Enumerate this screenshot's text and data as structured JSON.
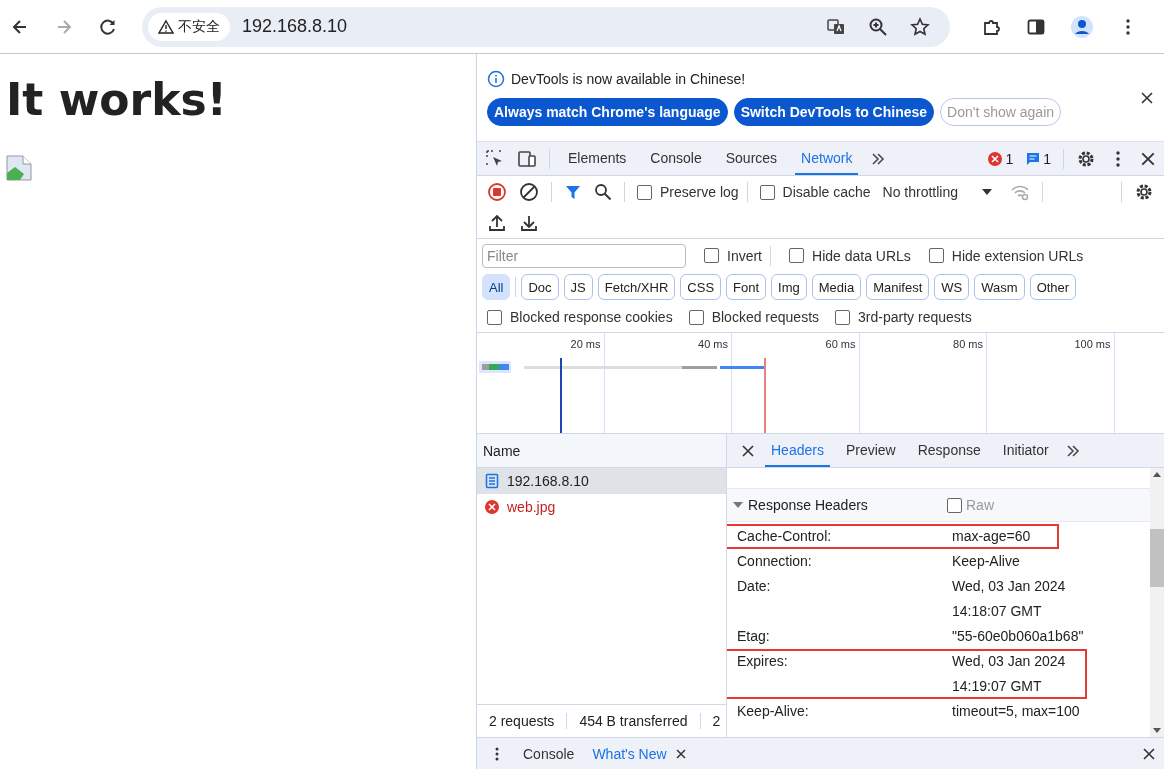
{
  "browser": {
    "forward_disabled": true,
    "security_label": "不安全",
    "url": "192.168.8.10"
  },
  "page": {
    "heading": "It works!"
  },
  "infobar": {
    "message": "DevTools is now available in Chinese!",
    "buttons": [
      {
        "label": "Always match Chrome's language",
        "kind": "primary"
      },
      {
        "label": "Switch DevTools to Chinese",
        "kind": "primary"
      },
      {
        "label": "Don't show again",
        "kind": "outline"
      }
    ]
  },
  "tabs": [
    {
      "label": "Elements",
      "selected": false
    },
    {
      "label": "Console",
      "selected": false
    },
    {
      "label": "Sources",
      "selected": false
    },
    {
      "label": "Network",
      "selected": true
    }
  ],
  "errors": "1",
  "messages": "1",
  "toolbar": {
    "recording": true,
    "filter_active": true,
    "options": [
      {
        "label": "Preserve log",
        "checked": false
      },
      {
        "label": "Disable cache",
        "checked": false
      }
    ],
    "throttling": "No throttling"
  },
  "filter": {
    "placeholder": "Filter",
    "options": [
      {
        "label": "Invert",
        "checked": false
      },
      {
        "label": "Hide data URLs",
        "checked": false
      },
      {
        "label": "Hide extension URLs",
        "checked": false
      }
    ]
  },
  "type_filters": [
    {
      "label": "All",
      "selected": true
    },
    {
      "label": "Doc",
      "selected": false
    },
    {
      "label": "JS",
      "selected": false
    },
    {
      "label": "Fetch/XHR",
      "selected": false
    },
    {
      "label": "CSS",
      "selected": false
    },
    {
      "label": "Font",
      "selected": false
    },
    {
      "label": "Img",
      "selected": false
    },
    {
      "label": "Media",
      "selected": false
    },
    {
      "label": "Manifest",
      "selected": false
    },
    {
      "label": "WS",
      "selected": false
    },
    {
      "label": "Wasm",
      "selected": false
    },
    {
      "label": "Other",
      "selected": false
    }
  ],
  "blocked": [
    {
      "label": "Blocked response cookies",
      "checked": false
    },
    {
      "label": "Blocked requests",
      "checked": false
    },
    {
      "label": "3rd-party requests",
      "checked": false
    }
  ],
  "overview": {
    "ticks": [
      "20 ms",
      "40 ms",
      "60 ms",
      "80 ms",
      "100 ms"
    ]
  },
  "requests": {
    "column": "Name",
    "rows": [
      {
        "name": "192.168.8.10",
        "kind": "document",
        "selected": true
      },
      {
        "name": "web.jpg",
        "kind": "error",
        "selected": false
      }
    ]
  },
  "status_bar": [
    "2 requests",
    "454 B transferred",
    "2"
  ],
  "details": {
    "tabs": [
      {
        "label": "Headers",
        "selected": true
      },
      {
        "label": "Preview",
        "selected": false
      },
      {
        "label": "Response",
        "selected": false
      },
      {
        "label": "Initiator",
        "selected": false
      }
    ],
    "section": {
      "title": "Response Headers",
      "expanded": true,
      "raw_label": "Raw",
      "raw": false,
      "headers": [
        {
          "name": "Cache-Control:",
          "lines": [
            "max-age=60"
          ],
          "highlighted": true
        },
        {
          "name": "Connection:",
          "lines": [
            "Keep-Alive"
          ],
          "highlighted": false
        },
        {
          "name": "Date:",
          "lines": [
            "Wed, 03 Jan 2024",
            "14:18:07 GMT"
          ],
          "highlighted": false
        },
        {
          "name": "Etag:",
          "lines": [
            "\"55-60e0b060a1b68\""
          ],
          "highlighted": false
        },
        {
          "name": "Expires:",
          "lines": [
            "Wed, 03 Jan 2024",
            "14:19:07 GMT"
          ],
          "highlighted": true
        },
        {
          "name": "Keep-Alive:",
          "lines": [
            "timeout=5, max=100"
          ],
          "highlighted": false
        }
      ]
    }
  },
  "drawer": {
    "tabs": [
      {
        "label": "Console",
        "selected": false,
        "closable": false
      },
      {
        "label": "What's New",
        "selected": true,
        "closable": true
      }
    ]
  }
}
